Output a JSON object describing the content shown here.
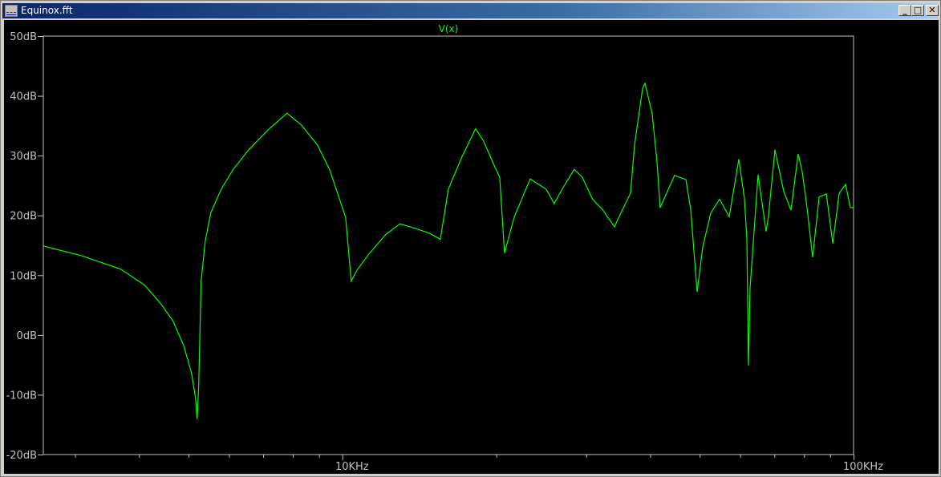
{
  "window": {
    "title": "Equinox.fft",
    "minimize": "_",
    "maximize": "□",
    "close": "✕"
  },
  "colors": {
    "trace": "#00ff00",
    "axis": "#c0c0c0",
    "background": "#000000"
  },
  "chart_data": {
    "type": "line",
    "title": "V(x)",
    "xlabel": "",
    "ylabel": "",
    "xscale": "log",
    "xlim": [
      2600,
      100000
    ],
    "ylim": [
      -20,
      50
    ],
    "grid": false,
    "yticks": [
      50,
      40,
      30,
      20,
      10,
      0,
      -10,
      -20
    ],
    "ytick_labels": [
      "50dB",
      "40dB",
      "30dB",
      "20dB",
      "10dB",
      "0dB",
      "-10dB",
      "-20dB"
    ],
    "xticks_labeled": [
      10000,
      100000
    ],
    "xtick_labels": [
      "10KHz",
      "100KHz"
    ],
    "xticks_minor": [
      3000,
      4000,
      5000,
      6000,
      7000,
      8000,
      9000,
      20000,
      30000,
      40000,
      50000,
      60000,
      70000,
      80000,
      90000
    ],
    "series": [
      {
        "name": "V(x)",
        "x": [
          2597,
          3078,
          3687,
          4110,
          4418,
          4666,
          4889,
          5069,
          5161,
          5199,
          5236,
          5293,
          5391,
          5527,
          5794,
          6116,
          6575,
          7196,
          7794,
          8317,
          8938,
          9438,
          9786,
          10146,
          10406,
          10711,
          11310,
          12155,
          12974,
          14049,
          14832,
          15544,
          16116,
          17133,
          18227,
          18897,
          19806,
          20313,
          20757,
          21675,
          23301,
          25041,
          25962,
          26918,
          28418,
          29463,
          30878,
          32262,
          34066,
          35318,
          36618,
          37283,
          38654,
          39075,
          40365,
          41247,
          41850,
          43074,
          44661,
          46985,
          48014,
          49428,
          50700,
          52563,
          54687,
          57117,
          59650,
          61179,
          61845,
          62288,
          62747,
          65054,
          67446,
          68180,
          70187,
          73023,
          75450,
          77942,
          79367,
          81104,
          83184,
          85633,
          88465,
          91067,
          93727,
          96486,
          98560,
          100000
        ],
        "y": [
          14.9,
          13.3,
          11.0,
          8.3,
          5.2,
          2.3,
          -1.7,
          -6.4,
          -10.5,
          -14.1,
          -8.4,
          9.0,
          15.7,
          20.4,
          24.4,
          27.7,
          31.1,
          34.5,
          37.1,
          35.1,
          31.8,
          27.7,
          23.7,
          19.7,
          9.0,
          11.0,
          13.7,
          16.8,
          18.6,
          17.7,
          17.0,
          16.0,
          24.4,
          29.8,
          34.5,
          32.4,
          28.4,
          26.4,
          13.7,
          19.7,
          26.1,
          24.4,
          22.0,
          24.4,
          27.7,
          26.4,
          22.7,
          21.0,
          18.1,
          21.0,
          23.7,
          31.8,
          41.2,
          42.1,
          37.1,
          29.1,
          21.3,
          23.7,
          26.7,
          26.0,
          21.0,
          7.2,
          14.7,
          20.4,
          22.7,
          19.8,
          29.4,
          22.8,
          16.0,
          -5.1,
          7.9,
          26.8,
          17.3,
          20.0,
          31.0,
          24.0,
          20.9,
          30.3,
          27.3,
          21.3,
          13.0,
          23.1,
          23.6,
          15.3,
          23.7,
          25.2,
          21.3,
          21.3
        ]
      }
    ]
  }
}
